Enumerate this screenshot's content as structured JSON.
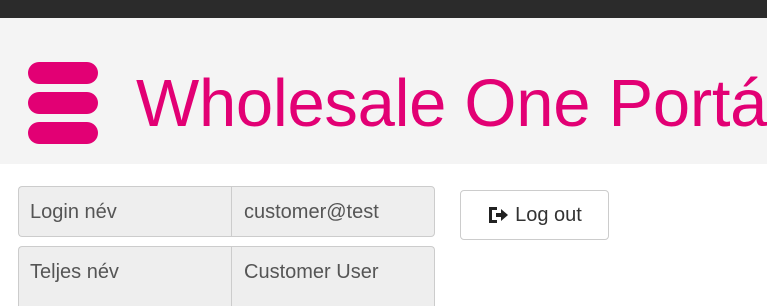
{
  "header": {
    "title": "Wholesale One Portál",
    "logo_icon": "database-icon",
    "brand_color": "#e20074"
  },
  "user_info": {
    "login": {
      "label": "Login név",
      "value": "customer@test"
    },
    "full_name": {
      "label": "Teljes név",
      "value": "Customer User"
    }
  },
  "actions": {
    "logout_label": "Log out",
    "logout_icon": "log-out-icon"
  }
}
